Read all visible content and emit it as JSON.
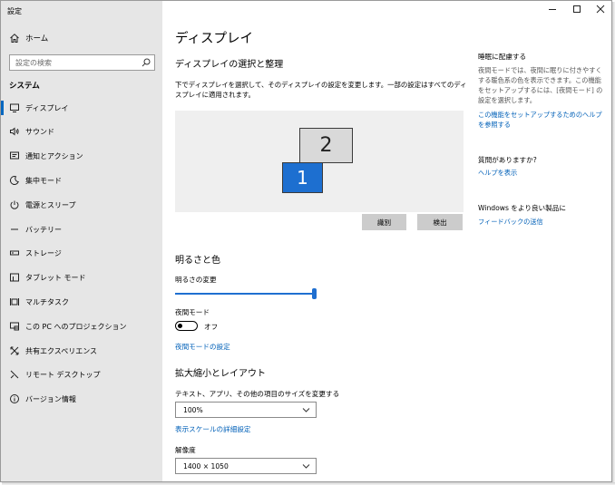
{
  "window": {
    "title": "設定"
  },
  "sidebar": {
    "home_label": "ホーム",
    "search_placeholder": "設定の検索",
    "section_label": "システム",
    "items": [
      {
        "label": "ディスプレイ",
        "icon": "monitor-icon"
      },
      {
        "label": "サウンド",
        "icon": "speaker-icon"
      },
      {
        "label": "通知とアクション",
        "icon": "notification-icon"
      },
      {
        "label": "集中モード",
        "icon": "moon-icon"
      },
      {
        "label": "電源とスリープ",
        "icon": "power-icon"
      },
      {
        "label": "バッテリー",
        "icon": "battery-icon"
      },
      {
        "label": "ストレージ",
        "icon": "storage-icon"
      },
      {
        "label": "タブレット モード",
        "icon": "tablet-icon"
      },
      {
        "label": "マルチタスク",
        "icon": "multitask-icon"
      },
      {
        "label": "この PC へのプロジェクション",
        "icon": "projection-icon"
      },
      {
        "label": "共有エクスペリエンス",
        "icon": "share-icon"
      },
      {
        "label": "リモート デスクトップ",
        "icon": "remote-icon"
      },
      {
        "label": "バージョン情報",
        "icon": "info-icon"
      }
    ]
  },
  "main": {
    "page_title": "ディスプレイ",
    "arrange": {
      "heading": "ディスプレイの選択と整理",
      "description": "下でディスプレイを選択して、そのディスプレイの設定を変更します。一部の設定はすべてのディスプレイに適用されます。",
      "monitor_1": "1",
      "monitor_2": "2",
      "identify_button": "識別",
      "detect_button": "検出"
    },
    "brightness": {
      "heading": "明るさと色",
      "slider_label": "明るさの変更",
      "slider_value_fraction": 1.0,
      "night_mode_label": "夜間モード",
      "night_mode_state": "オフ",
      "night_mode_settings_link": "夜間モードの設定"
    },
    "scale": {
      "heading": "拡大縮小とレイアウト",
      "size_label": "テキスト、アプリ、その他の項目のサイズを変更する",
      "size_value": "100%",
      "advanced_link": "表示スケールの詳細設定",
      "resolution_label": "解像度",
      "resolution_value": "1400 × 1050"
    }
  },
  "right_panel": {
    "sleep_heading": "睡眠に配慮する",
    "sleep_text": "夜間モードでは、夜間に眠りに付きやすくする暖色系の色を表示できます。この機能をセットアップするには、[夜間モード] の設定を選択します。",
    "sleep_link": "この機能をセットアップするためのヘルプを参照する",
    "question_heading": "質問がありますか?",
    "help_link": "ヘルプを表示",
    "feedback_heading": "Windows をより良い製品に",
    "feedback_link": "フィードバックの送信"
  },
  "colors": {
    "accent": "#0067c0",
    "sidebar_bg": "#e6e6e6",
    "link": "#0060b8",
    "monitor_selected": "#1d6fd0"
  }
}
